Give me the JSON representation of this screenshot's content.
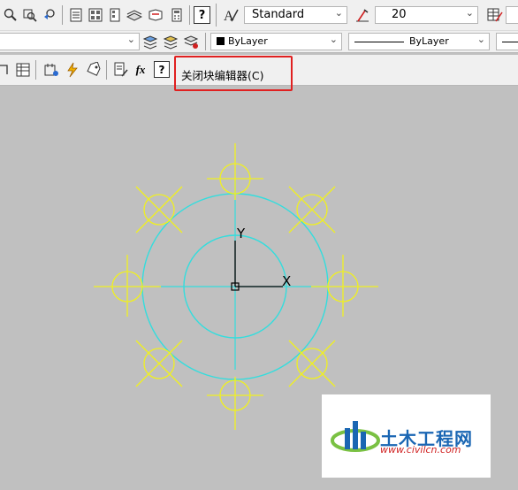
{
  "toolbar1": {
    "text_style": "Standard",
    "dim_style": "20",
    "help_glyph": "?"
  },
  "toolbar2": {
    "color": "ByLayer",
    "linetype": "ByLayer"
  },
  "block_editor": {
    "close_label": "关闭块编辑器(C)",
    "fx_glyph": "fx",
    "help_glyph": "?"
  },
  "drawing": {
    "y_axis_label": "Y",
    "x_axis_label": "X"
  },
  "watermark": {
    "title": "土木工程网",
    "url": "www.civilcn.com"
  },
  "colors": {
    "canvas": "#c0c0c0",
    "circle_cyan": "#33dddd",
    "bolt_yellow": "#f0f020",
    "highlight_red": "#e02020"
  }
}
